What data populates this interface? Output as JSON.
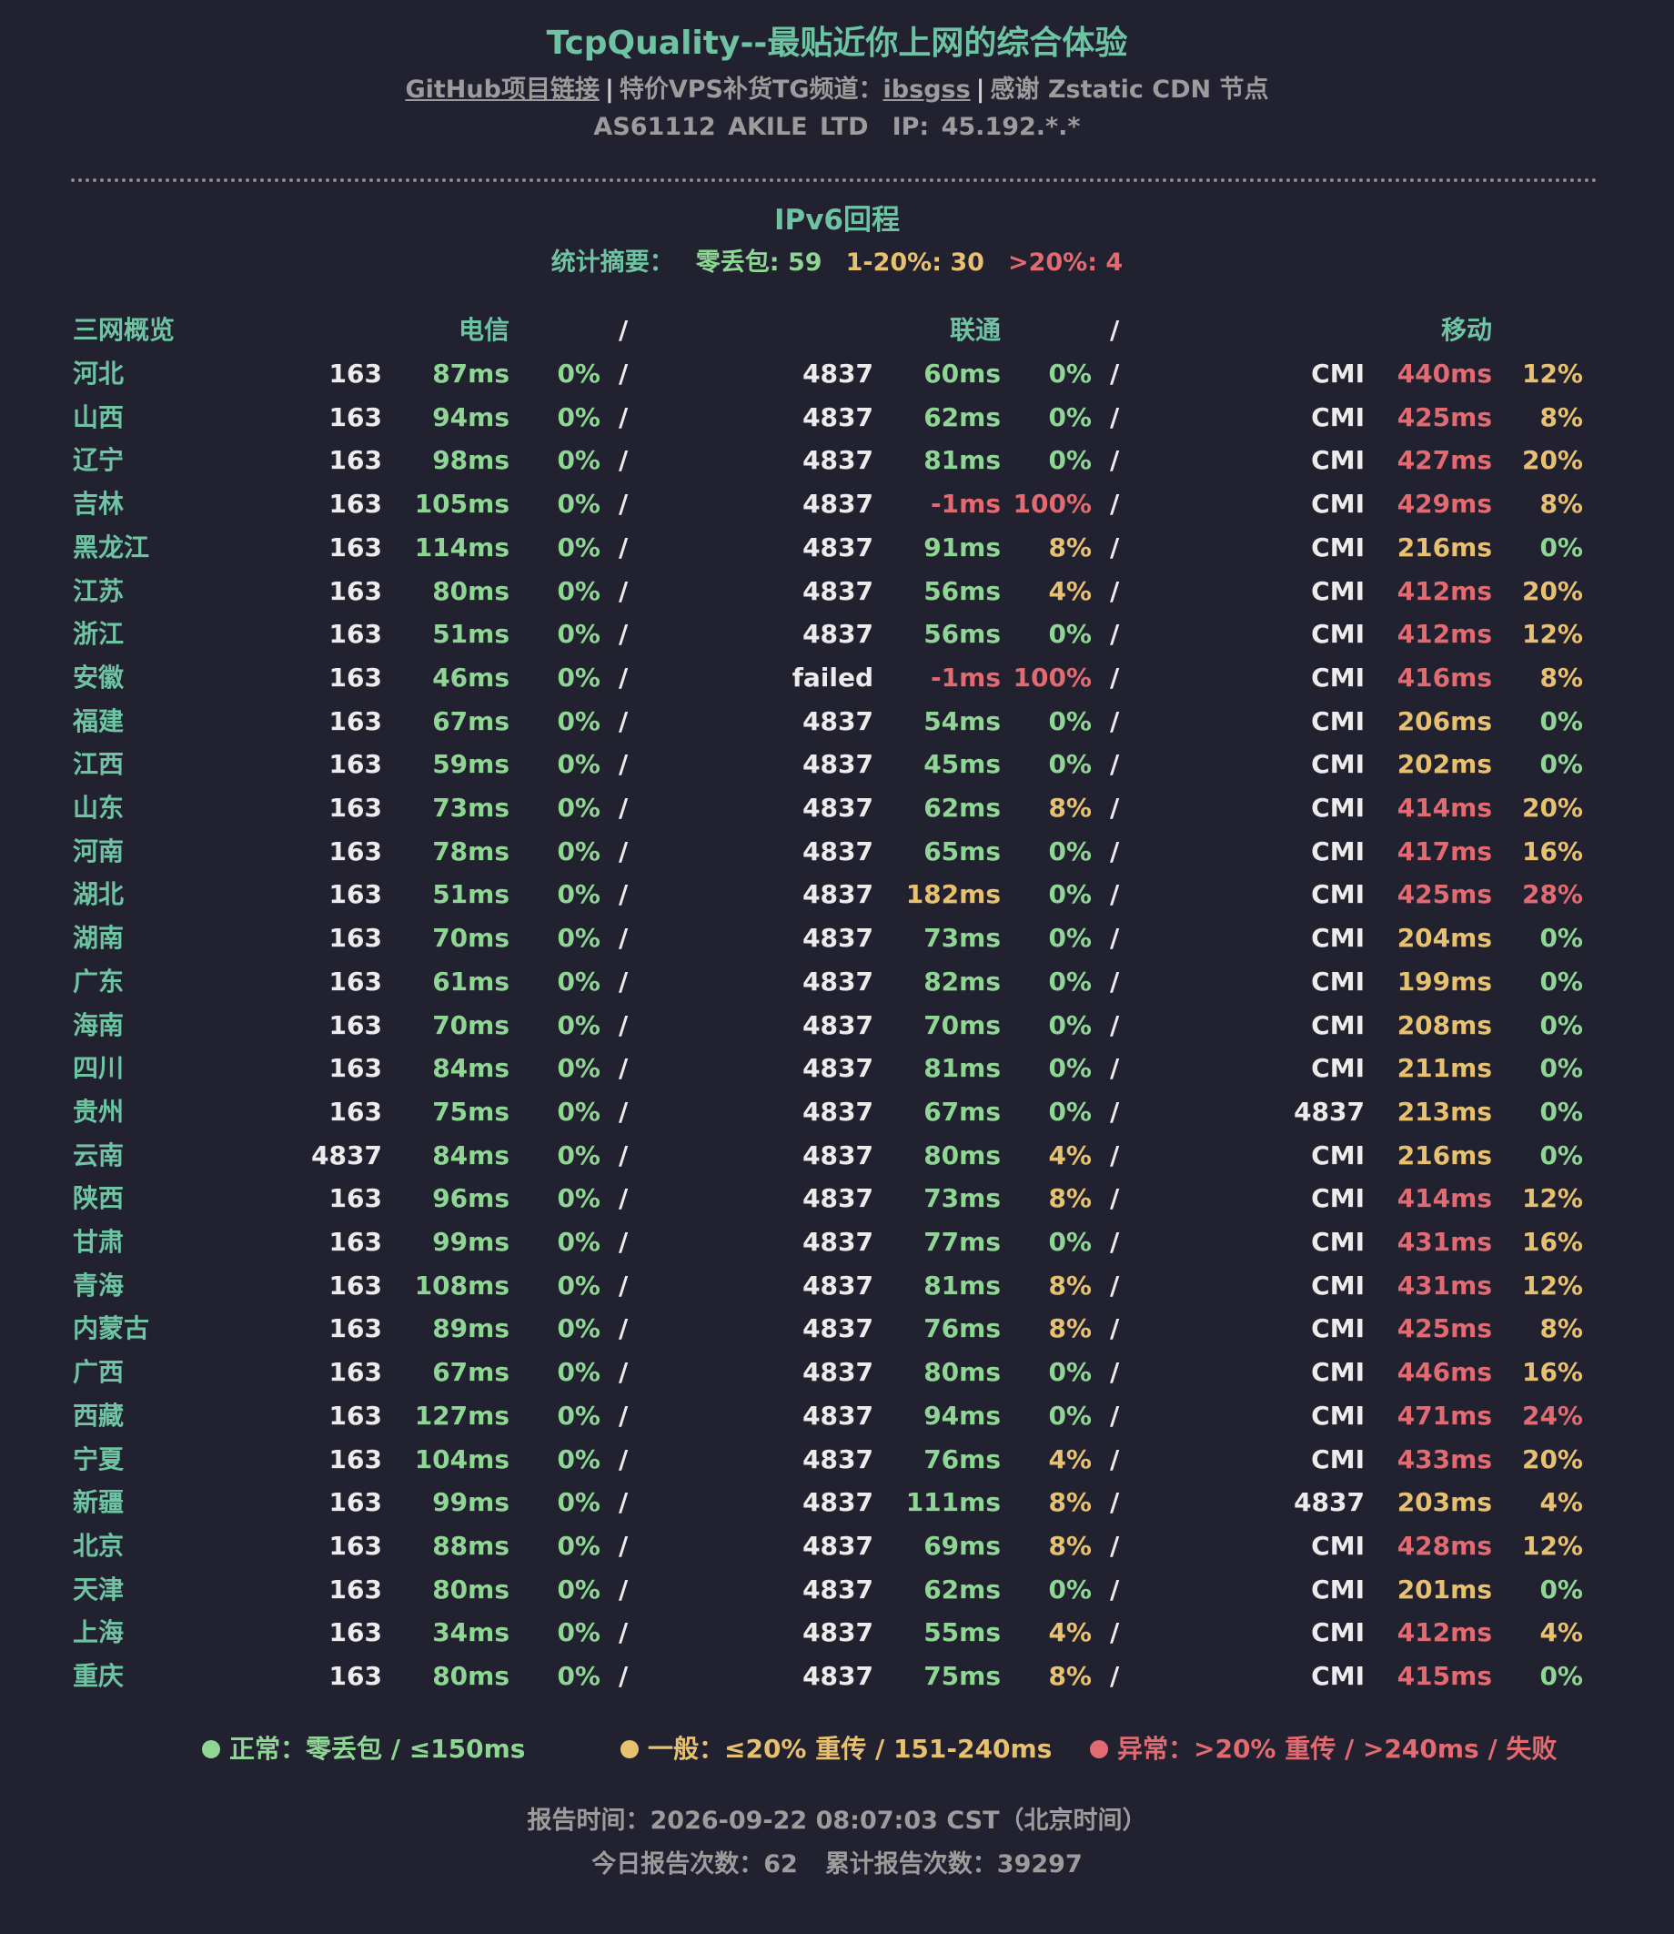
{
  "header": {
    "title": "TcpQuality--最贴近你上网的综合体验",
    "github_link": "GitHub项目链接",
    "separator": "|",
    "vps_text": "特价VPS补货TG频道：",
    "vps_link": "ibsgss",
    "thanks_text": "感谢 Zstatic CDN 节点",
    "asn": "AS61112 AKILE LTD",
    "ip": "IP: 45.192.*.*"
  },
  "section": {
    "title": "IPv6回程",
    "summary_label": "统计摘要：",
    "summary_zero": "零丢包: 59",
    "summary_mid": "1-20%: 30",
    "summary_high": ">20%: 4"
  },
  "table": {
    "headers": {
      "overview": "三网概览",
      "telecom": "电信",
      "unicom": "联通",
      "mobile": "移动",
      "slash": "/"
    },
    "rows": [
      {
        "province": "河北",
        "t": [
          "163",
          "87ms",
          "0%"
        ],
        "u": [
          "4837",
          "60ms",
          "0%"
        ],
        "m": [
          "CMI",
          "440ms",
          "12%"
        ],
        "tc": [
          "g",
          "g"
        ],
        "uc": [
          "g",
          "g"
        ],
        "mc": [
          "r",
          "y"
        ]
      },
      {
        "province": "山西",
        "t": [
          "163",
          "94ms",
          "0%"
        ],
        "u": [
          "4837",
          "62ms",
          "0%"
        ],
        "m": [
          "CMI",
          "425ms",
          "8%"
        ],
        "tc": [
          "g",
          "g"
        ],
        "uc": [
          "g",
          "g"
        ],
        "mc": [
          "r",
          "y"
        ]
      },
      {
        "province": "辽宁",
        "t": [
          "163",
          "98ms",
          "0%"
        ],
        "u": [
          "4837",
          "81ms",
          "0%"
        ],
        "m": [
          "CMI",
          "427ms",
          "20%"
        ],
        "tc": [
          "g",
          "g"
        ],
        "uc": [
          "g",
          "g"
        ],
        "mc": [
          "r",
          "y"
        ]
      },
      {
        "province": "吉林",
        "t": [
          "163",
          "105ms",
          "0%"
        ],
        "u": [
          "4837",
          "-1ms",
          "100%"
        ],
        "m": [
          "CMI",
          "429ms",
          "8%"
        ],
        "tc": [
          "g",
          "g"
        ],
        "uc": [
          "r",
          "r"
        ],
        "mc": [
          "r",
          "y"
        ]
      },
      {
        "province": "黑龙江",
        "t": [
          "163",
          "114ms",
          "0%"
        ],
        "u": [
          "4837",
          "91ms",
          "8%"
        ],
        "m": [
          "CMI",
          "216ms",
          "0%"
        ],
        "tc": [
          "g",
          "g"
        ],
        "uc": [
          "g",
          "y"
        ],
        "mc": [
          "y",
          "g"
        ]
      },
      {
        "province": "江苏",
        "t": [
          "163",
          "80ms",
          "0%"
        ],
        "u": [
          "4837",
          "56ms",
          "4%"
        ],
        "m": [
          "CMI",
          "412ms",
          "20%"
        ],
        "tc": [
          "g",
          "g"
        ],
        "uc": [
          "g",
          "y"
        ],
        "mc": [
          "r",
          "y"
        ]
      },
      {
        "province": "浙江",
        "t": [
          "163",
          "51ms",
          "0%"
        ],
        "u": [
          "4837",
          "56ms",
          "0%"
        ],
        "m": [
          "CMI",
          "412ms",
          "12%"
        ],
        "tc": [
          "g",
          "g"
        ],
        "uc": [
          "g",
          "g"
        ],
        "mc": [
          "r",
          "y"
        ]
      },
      {
        "province": "安徽",
        "t": [
          "163",
          "46ms",
          "0%"
        ],
        "u": [
          "failed",
          "-1ms",
          "100%"
        ],
        "m": [
          "CMI",
          "416ms",
          "8%"
        ],
        "tc": [
          "g",
          "g"
        ],
        "uc": [
          "r",
          "r"
        ],
        "mc": [
          "r",
          "y"
        ]
      },
      {
        "province": "福建",
        "t": [
          "163",
          "67ms",
          "0%"
        ],
        "u": [
          "4837",
          "54ms",
          "0%"
        ],
        "m": [
          "CMI",
          "206ms",
          "0%"
        ],
        "tc": [
          "g",
          "g"
        ],
        "uc": [
          "g",
          "g"
        ],
        "mc": [
          "y",
          "g"
        ]
      },
      {
        "province": "江西",
        "t": [
          "163",
          "59ms",
          "0%"
        ],
        "u": [
          "4837",
          "45ms",
          "0%"
        ],
        "m": [
          "CMI",
          "202ms",
          "0%"
        ],
        "tc": [
          "g",
          "g"
        ],
        "uc": [
          "g",
          "g"
        ],
        "mc": [
          "y",
          "g"
        ]
      },
      {
        "province": "山东",
        "t": [
          "163",
          "73ms",
          "0%"
        ],
        "u": [
          "4837",
          "62ms",
          "8%"
        ],
        "m": [
          "CMI",
          "414ms",
          "20%"
        ],
        "tc": [
          "g",
          "g"
        ],
        "uc": [
          "g",
          "y"
        ],
        "mc": [
          "r",
          "y"
        ]
      },
      {
        "province": "河南",
        "t": [
          "163",
          "78ms",
          "0%"
        ],
        "u": [
          "4837",
          "65ms",
          "0%"
        ],
        "m": [
          "CMI",
          "417ms",
          "16%"
        ],
        "tc": [
          "g",
          "g"
        ],
        "uc": [
          "g",
          "g"
        ],
        "mc": [
          "r",
          "y"
        ]
      },
      {
        "province": "湖北",
        "t": [
          "163",
          "51ms",
          "0%"
        ],
        "u": [
          "4837",
          "182ms",
          "0%"
        ],
        "m": [
          "CMI",
          "425ms",
          "28%"
        ],
        "tc": [
          "g",
          "g"
        ],
        "uc": [
          "y",
          "g"
        ],
        "mc": [
          "r",
          "r"
        ]
      },
      {
        "province": "湖南",
        "t": [
          "163",
          "70ms",
          "0%"
        ],
        "u": [
          "4837",
          "73ms",
          "0%"
        ],
        "m": [
          "CMI",
          "204ms",
          "0%"
        ],
        "tc": [
          "g",
          "g"
        ],
        "uc": [
          "g",
          "g"
        ],
        "mc": [
          "y",
          "g"
        ]
      },
      {
        "province": "广东",
        "t": [
          "163",
          "61ms",
          "0%"
        ],
        "u": [
          "4837",
          "82ms",
          "0%"
        ],
        "m": [
          "CMI",
          "199ms",
          "0%"
        ],
        "tc": [
          "g",
          "g"
        ],
        "uc": [
          "g",
          "g"
        ],
        "mc": [
          "y",
          "g"
        ]
      },
      {
        "province": "海南",
        "t": [
          "163",
          "70ms",
          "0%"
        ],
        "u": [
          "4837",
          "70ms",
          "0%"
        ],
        "m": [
          "CMI",
          "208ms",
          "0%"
        ],
        "tc": [
          "g",
          "g"
        ],
        "uc": [
          "g",
          "g"
        ],
        "mc": [
          "y",
          "g"
        ]
      },
      {
        "province": "四川",
        "t": [
          "163",
          "84ms",
          "0%"
        ],
        "u": [
          "4837",
          "81ms",
          "0%"
        ],
        "m": [
          "CMI",
          "211ms",
          "0%"
        ],
        "tc": [
          "g",
          "g"
        ],
        "uc": [
          "g",
          "g"
        ],
        "mc": [
          "y",
          "g"
        ]
      },
      {
        "province": "贵州",
        "t": [
          "163",
          "75ms",
          "0%"
        ],
        "u": [
          "4837",
          "67ms",
          "0%"
        ],
        "m": [
          "4837",
          "213ms",
          "0%"
        ],
        "tc": [
          "g",
          "g"
        ],
        "uc": [
          "g",
          "g"
        ],
        "mc": [
          "y",
          "g"
        ]
      },
      {
        "province": "云南",
        "t": [
          "4837",
          "84ms",
          "0%"
        ],
        "u": [
          "4837",
          "80ms",
          "4%"
        ],
        "m": [
          "CMI",
          "216ms",
          "0%"
        ],
        "tc": [
          "g",
          "g"
        ],
        "uc": [
          "g",
          "y"
        ],
        "mc": [
          "y",
          "g"
        ]
      },
      {
        "province": "陕西",
        "t": [
          "163",
          "96ms",
          "0%"
        ],
        "u": [
          "4837",
          "73ms",
          "8%"
        ],
        "m": [
          "CMI",
          "414ms",
          "12%"
        ],
        "tc": [
          "g",
          "g"
        ],
        "uc": [
          "g",
          "y"
        ],
        "mc": [
          "r",
          "y"
        ]
      },
      {
        "province": "甘肃",
        "t": [
          "163",
          "99ms",
          "0%"
        ],
        "u": [
          "4837",
          "77ms",
          "0%"
        ],
        "m": [
          "CMI",
          "431ms",
          "16%"
        ],
        "tc": [
          "g",
          "g"
        ],
        "uc": [
          "g",
          "g"
        ],
        "mc": [
          "r",
          "y"
        ]
      },
      {
        "province": "青海",
        "t": [
          "163",
          "108ms",
          "0%"
        ],
        "u": [
          "4837",
          "81ms",
          "8%"
        ],
        "m": [
          "CMI",
          "431ms",
          "12%"
        ],
        "tc": [
          "g",
          "g"
        ],
        "uc": [
          "g",
          "y"
        ],
        "mc": [
          "r",
          "y"
        ]
      },
      {
        "province": "内蒙古",
        "t": [
          "163",
          "89ms",
          "0%"
        ],
        "u": [
          "4837",
          "76ms",
          "8%"
        ],
        "m": [
          "CMI",
          "425ms",
          "8%"
        ],
        "tc": [
          "g",
          "g"
        ],
        "uc": [
          "g",
          "y"
        ],
        "mc": [
          "r",
          "y"
        ]
      },
      {
        "province": "广西",
        "t": [
          "163",
          "67ms",
          "0%"
        ],
        "u": [
          "4837",
          "80ms",
          "0%"
        ],
        "m": [
          "CMI",
          "446ms",
          "16%"
        ],
        "tc": [
          "g",
          "g"
        ],
        "uc": [
          "g",
          "g"
        ],
        "mc": [
          "r",
          "y"
        ]
      },
      {
        "province": "西藏",
        "t": [
          "163",
          "127ms",
          "0%"
        ],
        "u": [
          "4837",
          "94ms",
          "0%"
        ],
        "m": [
          "CMI",
          "471ms",
          "24%"
        ],
        "tc": [
          "g",
          "g"
        ],
        "uc": [
          "g",
          "g"
        ],
        "mc": [
          "r",
          "r"
        ]
      },
      {
        "province": "宁夏",
        "t": [
          "163",
          "104ms",
          "0%"
        ],
        "u": [
          "4837",
          "76ms",
          "4%"
        ],
        "m": [
          "CMI",
          "433ms",
          "20%"
        ],
        "tc": [
          "g",
          "g"
        ],
        "uc": [
          "g",
          "y"
        ],
        "mc": [
          "r",
          "y"
        ]
      },
      {
        "province": "新疆",
        "t": [
          "163",
          "99ms",
          "0%"
        ],
        "u": [
          "4837",
          "111ms",
          "8%"
        ],
        "m": [
          "4837",
          "203ms",
          "4%"
        ],
        "tc": [
          "g",
          "g"
        ],
        "uc": [
          "g",
          "y"
        ],
        "mc": [
          "y",
          "y"
        ]
      },
      {
        "province": "北京",
        "t": [
          "163",
          "88ms",
          "0%"
        ],
        "u": [
          "4837",
          "69ms",
          "8%"
        ],
        "m": [
          "CMI",
          "428ms",
          "12%"
        ],
        "tc": [
          "g",
          "g"
        ],
        "uc": [
          "g",
          "y"
        ],
        "mc": [
          "r",
          "y"
        ]
      },
      {
        "province": "天津",
        "t": [
          "163",
          "80ms",
          "0%"
        ],
        "u": [
          "4837",
          "62ms",
          "0%"
        ],
        "m": [
          "CMI",
          "201ms",
          "0%"
        ],
        "tc": [
          "g",
          "g"
        ],
        "uc": [
          "g",
          "g"
        ],
        "mc": [
          "y",
          "g"
        ]
      },
      {
        "province": "上海",
        "t": [
          "163",
          "34ms",
          "0%"
        ],
        "u": [
          "4837",
          "55ms",
          "4%"
        ],
        "m": [
          "CMI",
          "412ms",
          "4%"
        ],
        "tc": [
          "g",
          "g"
        ],
        "uc": [
          "g",
          "y"
        ],
        "mc": [
          "r",
          "y"
        ]
      },
      {
        "province": "重庆",
        "t": [
          "163",
          "80ms",
          "0%"
        ],
        "u": [
          "4837",
          "75ms",
          "8%"
        ],
        "m": [
          "CMI",
          "415ms",
          "0%"
        ],
        "tc": [
          "g",
          "g"
        ],
        "uc": [
          "g",
          "y"
        ],
        "mc": [
          "r",
          "g"
        ]
      }
    ]
  },
  "legend": {
    "normal": "正常：零丢包 / ≤150ms",
    "medium": "一般：≤20% 重传 / 151-240ms",
    "abnormal": "异常：>20% 重传 / >240ms / 失败",
    "colors": {
      "normal": "#8fd694",
      "medium": "#e8c170",
      "abnormal": "#e26a71"
    }
  },
  "footer": {
    "report_time": "报告时间：2026-09-22 08:07:03 CST（北京时间）",
    "today_count": "今日报告次数：62",
    "total_count": "累计报告次数：39297"
  }
}
